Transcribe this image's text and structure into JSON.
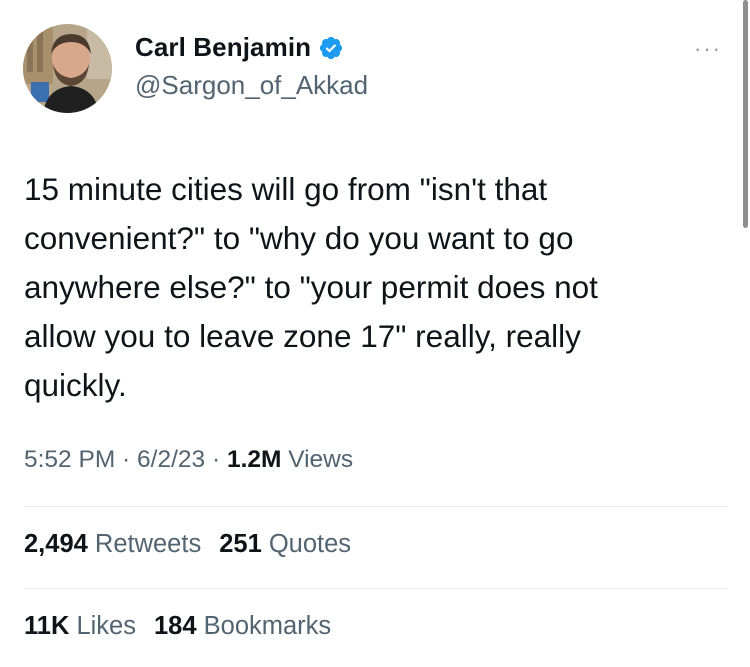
{
  "author": {
    "name": "Carl Benjamin",
    "handle": "@Sargon_of_Akkad",
    "verified": true,
    "verified_color": "#1d9bf0"
  },
  "more_menu": "···",
  "tweet": {
    "text": "15 minute cities will go from \"isn't that\nconvenient?\" to \"why do you want to go\nanywhere else?\" to \"your permit does not\nallow you to leave zone 17\" really, really\nquickly."
  },
  "meta": {
    "time": "5:52 PM",
    "sep1": " · ",
    "date": "6/2/23",
    "sep2": " · ",
    "views_count": "1.2M",
    "views_label": " Views"
  },
  "engagement": {
    "retweets_count": "2,494",
    "retweets_label": " Retweets",
    "quotes_count": "251",
    "quotes_label": " Quotes",
    "likes_count": "11K",
    "likes_label": " Likes",
    "bookmarks_count": "184",
    "bookmarks_label": " Bookmarks"
  }
}
